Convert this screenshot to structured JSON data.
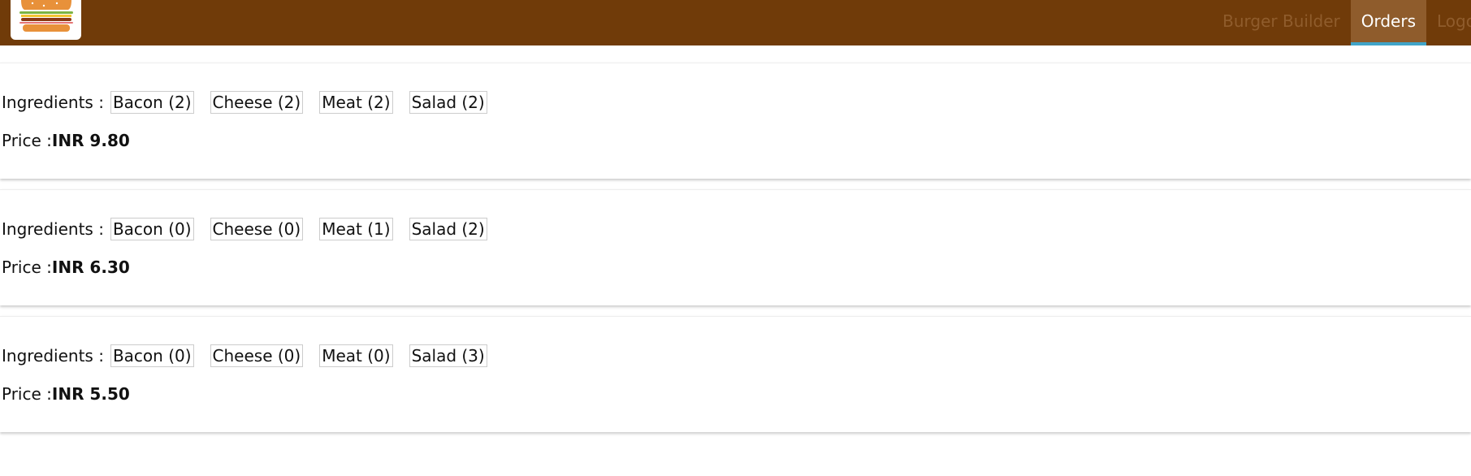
{
  "nav": {
    "items": [
      {
        "label": "Burger Builder",
        "active": false
      },
      {
        "label": "Orders",
        "active": true
      },
      {
        "label": "Logout",
        "active": false
      }
    ]
  },
  "colors": {
    "toolbar": "#703b09",
    "active_tab": "#8f5c2c",
    "active_underline": "#40a4c8"
  },
  "logo": {
    "icon": "burger-logo-icon"
  },
  "orders": [
    {
      "ingredients_label": "Ingredients :",
      "ingredients": [
        "Bacon (2)",
        "Cheese (2)",
        "Meat (2)",
        "Salad (2)"
      ],
      "price_label": "Price :",
      "price": "INR 9.80"
    },
    {
      "ingredients_label": "Ingredients :",
      "ingredients": [
        "Bacon (0)",
        "Cheese (0)",
        "Meat (1)",
        "Salad (2)"
      ],
      "price_label": "Price :",
      "price": "INR 6.30"
    },
    {
      "ingredients_label": "Ingredients :",
      "ingredients": [
        "Bacon (0)",
        "Cheese (0)",
        "Meat (0)",
        "Salad (3)"
      ],
      "price_label": "Price :",
      "price": "INR 5.50"
    }
  ]
}
